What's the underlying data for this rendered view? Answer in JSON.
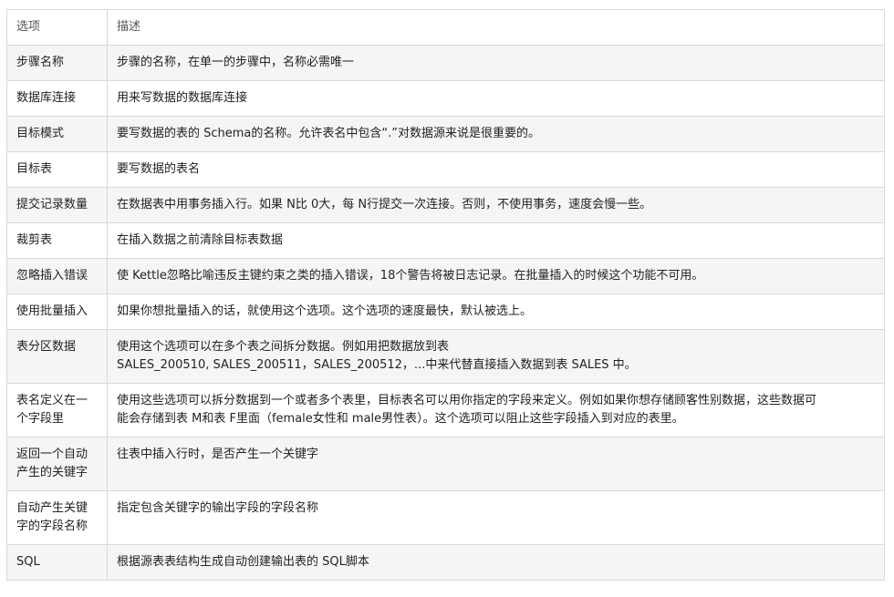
{
  "table": {
    "header": {
      "option": "选项",
      "description": "描述"
    },
    "rows": [
      {
        "option": "步骤名称",
        "description": "步骤的名称，在单一的步骤中，名称必需唯一"
      },
      {
        "option": "数据库连接",
        "description": "用来写数据的数据库连接"
      },
      {
        "option": "目标模式",
        "description": "要写数据的表的 Schema的名称。允许表名中包含“.”对数据源来说是很重要的。"
      },
      {
        "option": "目标表",
        "description": "要写数据的表名"
      },
      {
        "option": "提交记录数量",
        "description": "在数据表中用事务插入行。如果 N比 0大，每 N行提交一次连接。否则，不使用事务，速度会慢一些。"
      },
      {
        "option": "裁剪表",
        "description": "在插入数据之前清除目标表数据"
      },
      {
        "option": "忽略插入错误",
        "description": "使 Kettle忽略比喻违反主键约束之类的插入错误，18个警告将被日志记录。在批量插入的时候这个功能不可用。"
      },
      {
        "option": "使用批量插入",
        "description": "如果你想批量插入的话，就使用这个选项。这个选项的速度最快，默认被选上。"
      },
      {
        "option": "表分区数据",
        "description_lines": [
          "使用这个选项可以在多个表之间拆分数据。例如用把数据放到表",
          "SALES_200510, SALES_200511，SALES_200512，...中来代替直接插入数据到表 SALES 中。"
        ]
      },
      {
        "option_lines": [
          "表名定义在一",
          "个字段里"
        ],
        "description_lines": [
          "使用这些选项可以拆分数据到一个或者多个表里，目标表名可以用你指定的字段来定义。例如如果你想存储顾客性别数据，这些数据可",
          "能会存储到表 M和表 F里面（female女性和 male男性表）。这个选项可以阻止这些字段插入到对应的表里。"
        ]
      },
      {
        "option_lines": [
          "返回一个自动",
          "产生的关键字"
        ],
        "description": "往表中插入行时，是否产生一个关键字"
      },
      {
        "option_lines": [
          "自动产生关键",
          "字的字段名称"
        ],
        "description": "指定包含关键字的输出字段的字段名称"
      },
      {
        "option": "SQL",
        "description": "根据源表表结构生成自动创建输出表的 SQL脚本"
      }
    ]
  }
}
